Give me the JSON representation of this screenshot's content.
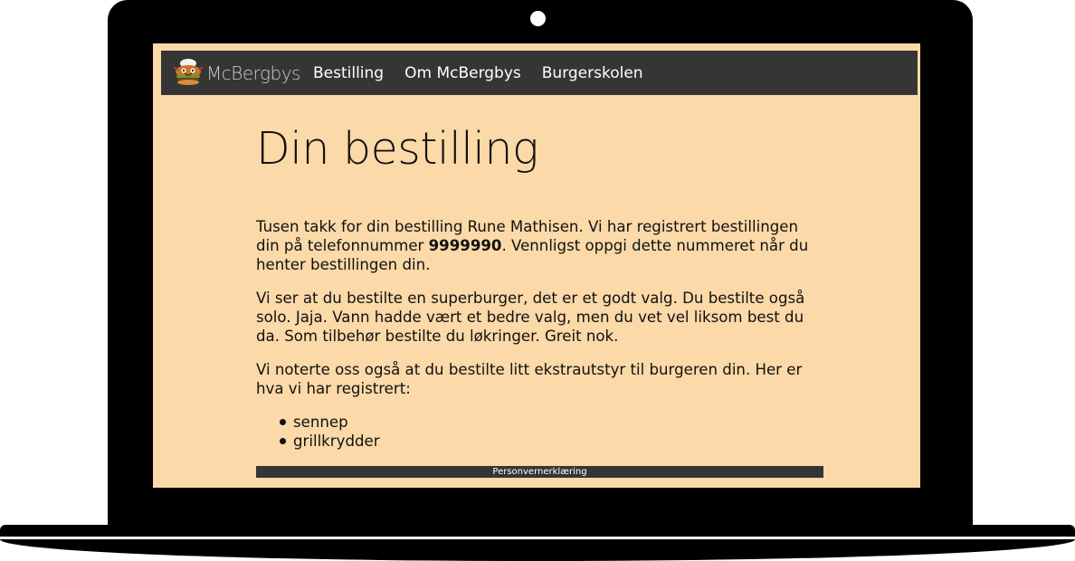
{
  "nav": {
    "logo_text": "McBergbys",
    "logo_icon": "burger-mascot-icon",
    "links": [
      "Bestilling",
      "Om McBergbys",
      "Burgerskolen"
    ]
  },
  "main": {
    "title": "Din bestilling",
    "p1_before": "Tusen takk for din bestilling Rune Mathisen. Vi har registrert bestillingen din på telefonnummer ",
    "p1_phone": "9999990",
    "p1_after": ". Vennligst oppgi dette nummeret når du henter bestillingen din.",
    "p2": "Vi ser at du bestilte en superburger, det er et godt valg. Du bestilte også solo. Jaja. Vann hadde vært et bedre valg, men du vet vel liksom best du da. Som tilbehør bestilte du løkringer. Greit nok.",
    "p3": "Vi noterte oss også at du bestilte litt ekstrautstyr til burgeren din. Her er hva vi har registrert:",
    "extras": [
      "sennep",
      "grillkrydder"
    ]
  },
  "footer": {
    "link": "Personvernerklæring"
  },
  "colors": {
    "page_background": "#fbd9a8",
    "nav_background": "#353535",
    "device": "#000000"
  }
}
